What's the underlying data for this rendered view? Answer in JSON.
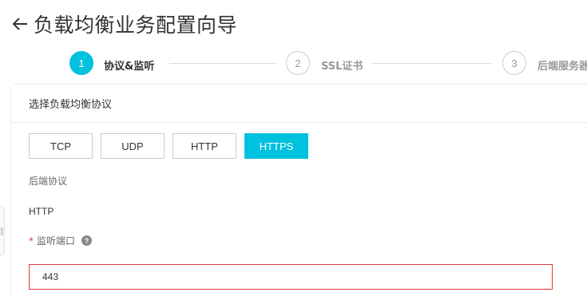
{
  "header": {
    "back_icon": "arrow-left-icon",
    "title": "负载均衡业务配置向导"
  },
  "steps": [
    {
      "number": "1",
      "label": "协议&监听",
      "state": "active"
    },
    {
      "number": "2",
      "label": "SSL证书",
      "state": "inactive"
    },
    {
      "number": "3",
      "label": "后端服务器",
      "state": "inactive"
    }
  ],
  "card": {
    "title": "选择负载均衡协议",
    "protocols": [
      "TCP",
      "UDP",
      "HTTP",
      "HTTPS"
    ],
    "selected_protocol": "HTTPS",
    "backend_protocol_label": "后端协议",
    "backend_protocol_value": "HTTP",
    "listen_port_label": "监听端口",
    "required_mark": "*",
    "help_icon": "question-circle-icon",
    "help_glyph": "?",
    "listen_port_value": "443"
  },
  "colors": {
    "accent": "#00c1de",
    "error_border": "#e4393c",
    "required": "#e4393c"
  }
}
